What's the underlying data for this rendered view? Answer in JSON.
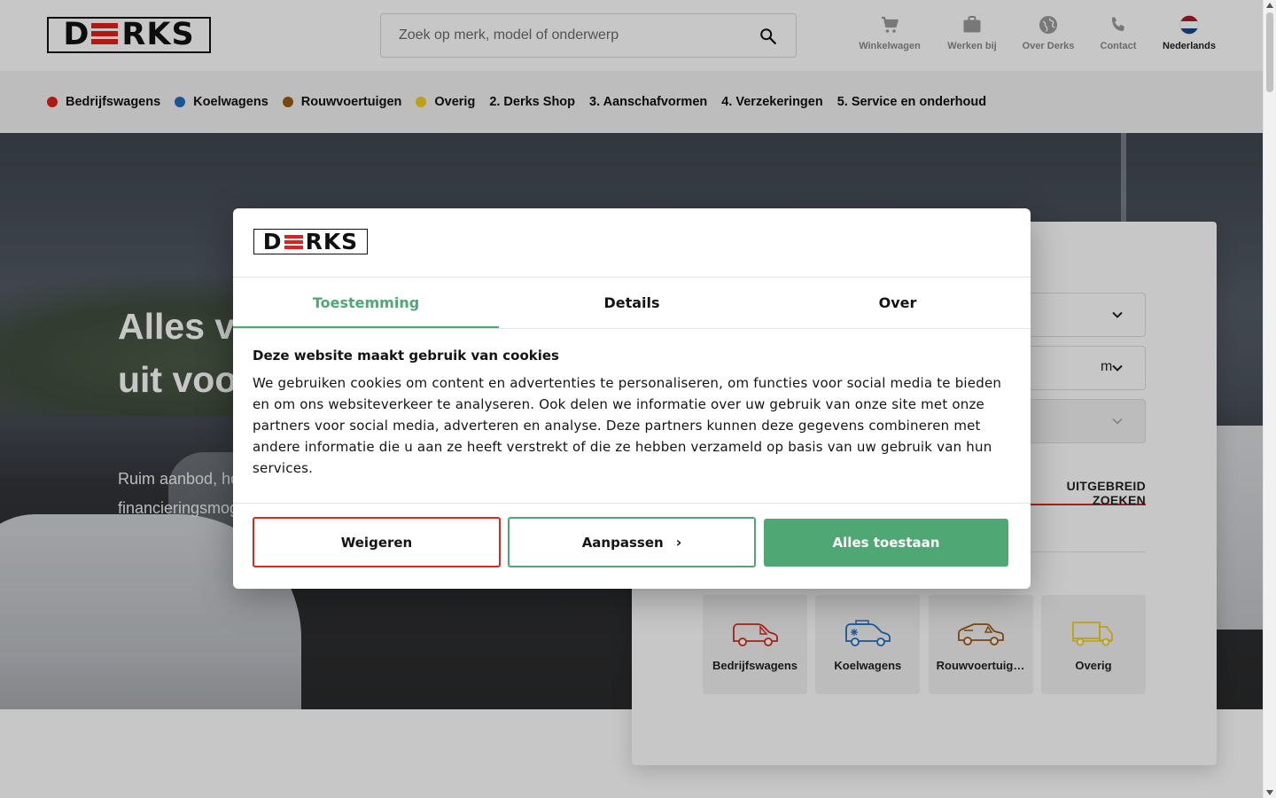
{
  "header": {
    "logo_text_left": "D",
    "logo_text_right": "RKS",
    "search_placeholder": "Zoek op merk, model of onderwerp",
    "links": [
      {
        "label": "Winkelwagen",
        "icon": "cart-icon"
      },
      {
        "label": "Werken bij",
        "icon": "briefcase-icon"
      },
      {
        "label": "Over Derks",
        "icon": "globe-icon"
      },
      {
        "label": "Contact",
        "icon": "phone-icon"
      },
      {
        "label": "Nederlands",
        "icon": "dutch-flag-icon"
      }
    ]
  },
  "nav": {
    "items": [
      {
        "label": "Bedrijfswagens",
        "dot": "#e3201b"
      },
      {
        "label": "Koelwagens",
        "dot": "#1f6fc0"
      },
      {
        "label": "Rouwvoertuigen",
        "dot": "#9c5a12"
      },
      {
        "label": "Overig",
        "dot": "#f3cf1b"
      },
      {
        "label": "2. Derks Shop"
      },
      {
        "label": "3. Aanschafvormen"
      },
      {
        "label": "4. Verzekeringen"
      },
      {
        "label": "5. Service en onderhoud"
      }
    ]
  },
  "hero": {
    "title": "Alles voor uw bedrijfswagen uit voorraad",
    "subtitle": "Ruim aanbod, hoge kwaliteit, direct uit voorraad en financieringsmogelijkheden voor uw bedrijfswagen"
  },
  "search_panel": {
    "select_2_value": "m",
    "advanced_label": "UITGEBREID ZOEKEN",
    "categories": [
      {
        "label": "Bedrijfswagens",
        "color": "#d52b1e",
        "icon": "van-icon"
      },
      {
        "label": "Koelwagens",
        "color": "#1f6fc0",
        "icon": "refrigerated-van-icon"
      },
      {
        "label": "Rouwvoertuigen",
        "color": "#9c5a12",
        "icon": "hearse-icon"
      },
      {
        "label": "Overig",
        "color": "#f3cf1b",
        "icon": "trailer-icon"
      }
    ]
  },
  "cookie_dialog": {
    "tabs": [
      {
        "label": "Toestemming",
        "active": true
      },
      {
        "label": "Details",
        "active": false
      },
      {
        "label": "Over",
        "active": false
      }
    ],
    "heading": "Deze website maakt gebruik van cookies",
    "body": "We gebruiken cookies om content en advertenties te personaliseren, om functies voor social media te bieden en om ons websiteverkeer te analyseren. Ook delen we informatie over uw gebruik van onze site met onze partners voor social media, adverteren en analyse. Deze partners kunnen deze gegevens combineren met andere informatie die u aan ze heeft verstrekt of die ze hebben verzameld op basis van uw gebruik van hun services.",
    "btn_refuse": "Weigeren",
    "btn_customize": "Aanpassen",
    "btn_accept": "Alles toestaan",
    "accent": "#4fa874"
  }
}
